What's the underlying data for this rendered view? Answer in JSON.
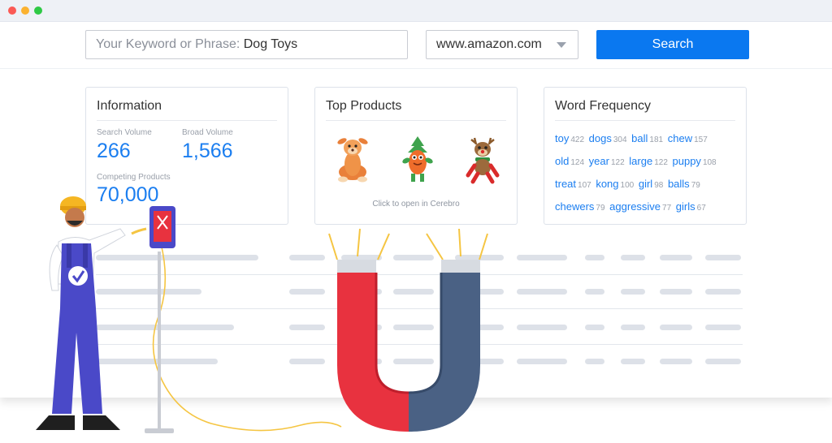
{
  "search": {
    "placeholder": "Your Keyword or Phrase:",
    "value": "Dog Toys"
  },
  "marketplace": {
    "selected": "www.amazon.com"
  },
  "search_button": {
    "label": "Search"
  },
  "information": {
    "title": "Information",
    "search_volume_label": "Search Volume",
    "search_volume": "266",
    "broad_volume_label": "Broad Volume",
    "broad_volume": "1,566",
    "competing_products_label": "Competing Products",
    "competing_products": "70,000"
  },
  "top_products": {
    "title": "Top Products",
    "caption": "Click to open in Cerebro",
    "products": [
      {
        "icon": "deer-plush-toy-icon"
      },
      {
        "icon": "carrot-plush-toy-icon"
      },
      {
        "icon": "reindeer-plush-toy-icon"
      }
    ]
  },
  "word_frequency": {
    "title": "Word Frequency",
    "words": [
      {
        "word": "toy",
        "count": "422"
      },
      {
        "word": "dogs",
        "count": "304"
      },
      {
        "word": "ball",
        "count": "181"
      },
      {
        "word": "chew",
        "count": "157"
      },
      {
        "word": "old",
        "count": "124"
      },
      {
        "word": "year",
        "count": "122"
      },
      {
        "word": "large",
        "count": "122"
      },
      {
        "word": "puppy",
        "count": "108"
      },
      {
        "word": "treat",
        "count": "107"
      },
      {
        "word": "kong",
        "count": "100"
      },
      {
        "word": "girl",
        "count": "98"
      },
      {
        "word": "balls",
        "count": "79"
      },
      {
        "word": "chewers",
        "count": "79"
      },
      {
        "word": "aggressive",
        "count": "77"
      },
      {
        "word": "girls",
        "count": "67"
      }
    ]
  },
  "colors": {
    "accent": "#0a78f0",
    "number_blue": "#1b7ef0",
    "magnet_red": "#e8323f",
    "magnet_blue": "#4a6184",
    "overalls": "#4a49c8",
    "window_close": "#fb5a55",
    "window_minimize": "#fbb230",
    "window_maximize": "#2ec945"
  }
}
